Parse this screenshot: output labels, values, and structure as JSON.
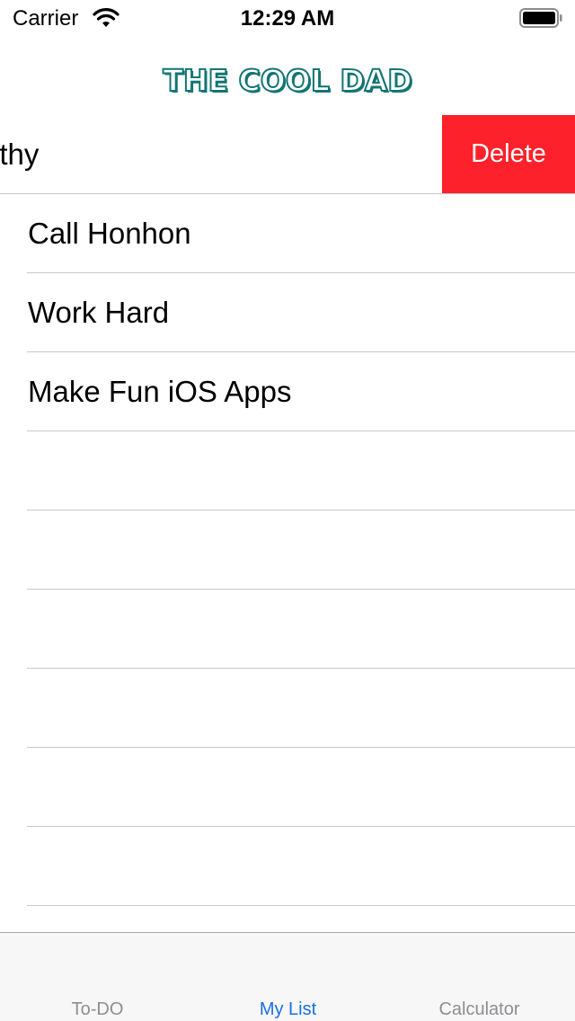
{
  "status_bar": {
    "carrier": "Carrier",
    "time": "12:29 AM"
  },
  "header": {
    "logo_text": "THE COOL DAD"
  },
  "list": {
    "swiped_item": {
      "visible_text": "lthy",
      "action_label": "Delete"
    },
    "items": [
      "Call Honhon",
      "Work Hard",
      "Make Fun iOS Apps"
    ]
  },
  "tab_bar": {
    "tabs": [
      {
        "label": "To-DO",
        "active": false
      },
      {
        "label": "My List",
        "active": true
      },
      {
        "label": "Calculator",
        "active": false
      }
    ]
  },
  "colors": {
    "brand": "#137574",
    "delete": "#fc212a",
    "tab_active": "#1a6fe0",
    "tab_inactive": "#8e8e93"
  }
}
